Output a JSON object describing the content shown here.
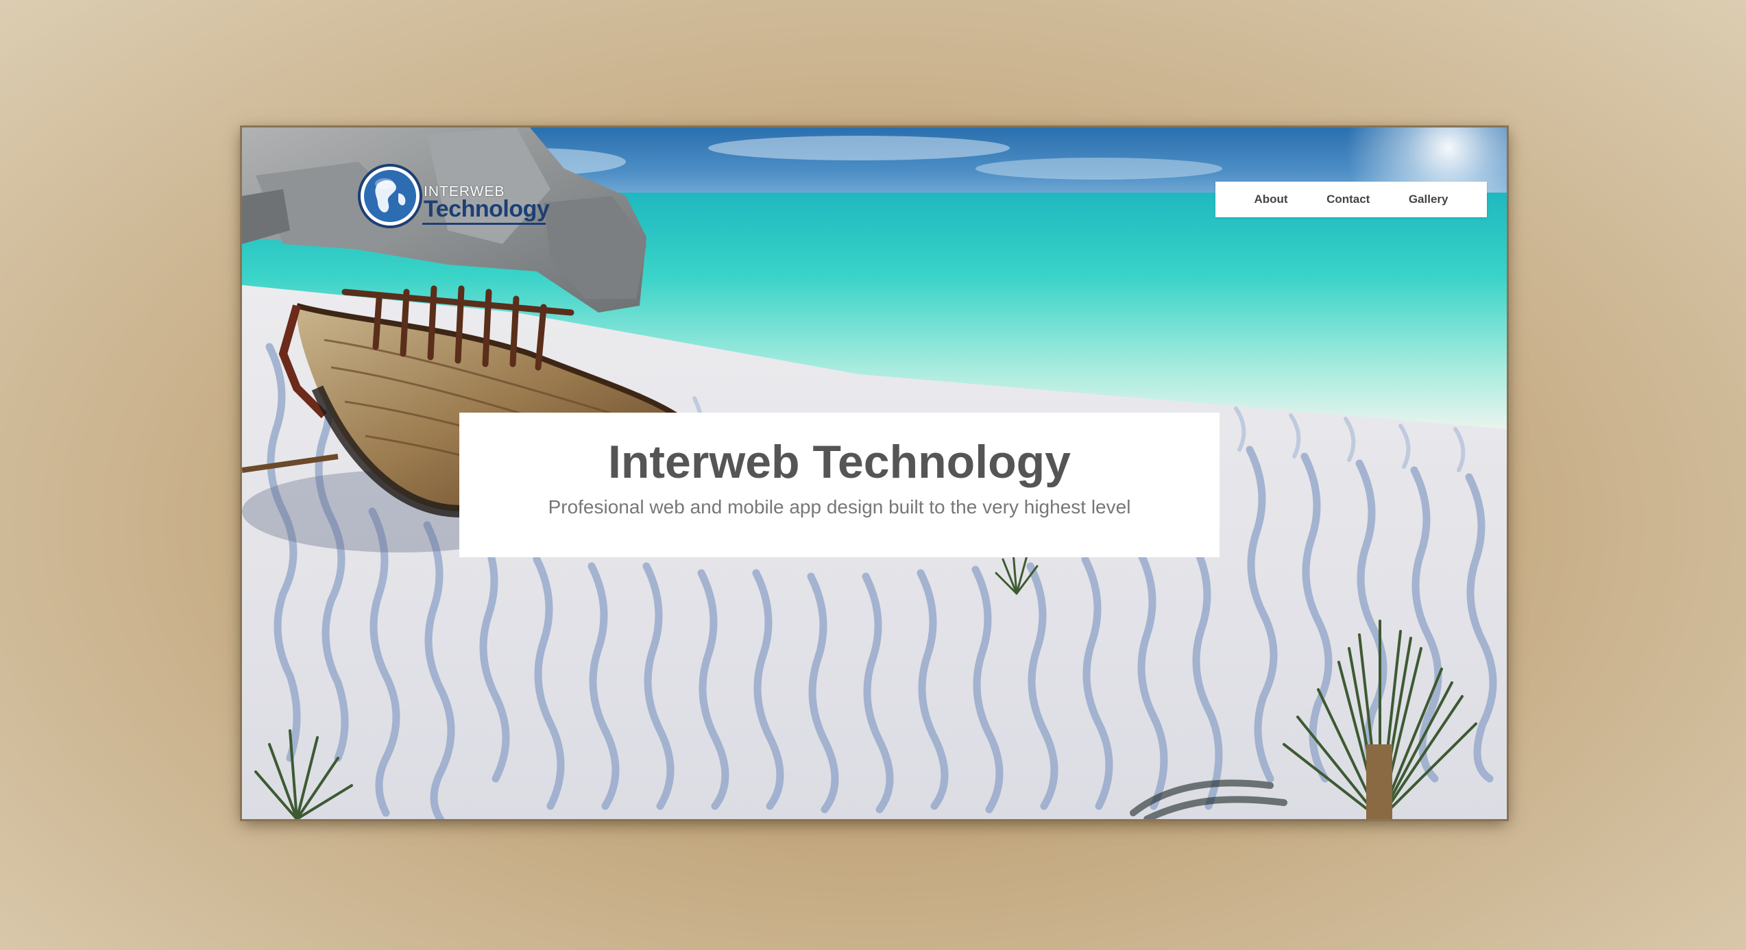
{
  "brand": {
    "small_text": "INTERWEB",
    "large_text": "Technology",
    "color": "#1c3f74"
  },
  "nav": {
    "items": [
      {
        "label": "About"
      },
      {
        "label": "Contact"
      },
      {
        "label": "Gallery"
      }
    ]
  },
  "hero": {
    "title": "Interweb Technology",
    "subtitle": "Profesional web and mobile app design built to the very highest level"
  },
  "colors": {
    "page_background": "#c2a67c",
    "sea": "#3fd1c6",
    "sky": "#2f78b8",
    "sand": "#e6e6ea",
    "text_dark": "#555555",
    "text_light": "#777777"
  },
  "background_image": "beach-shipwreck-scene"
}
